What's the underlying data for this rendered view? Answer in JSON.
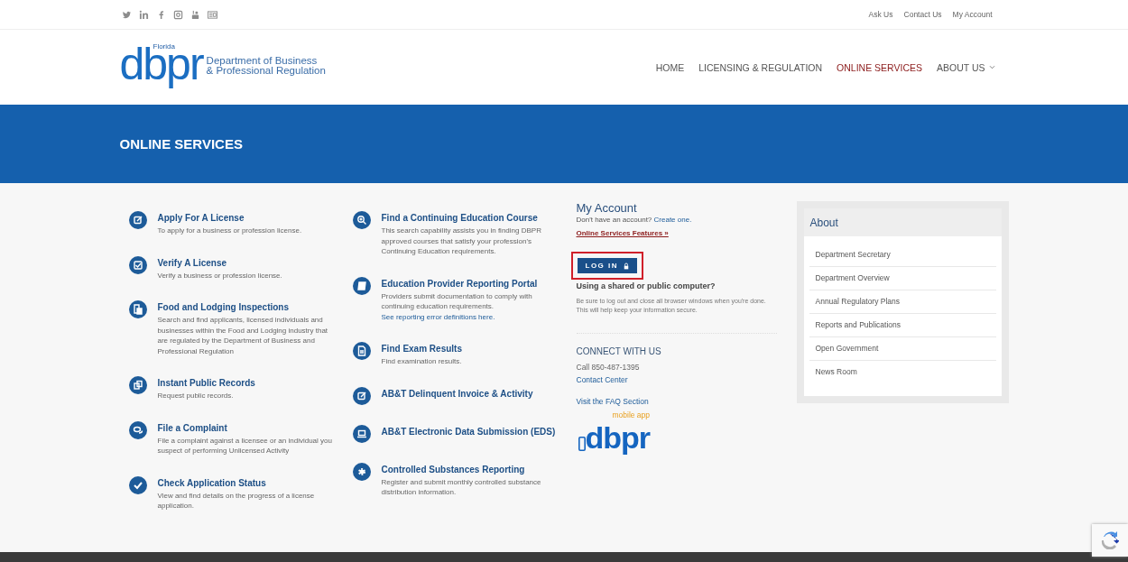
{
  "top_bar": {
    "links": [
      "Ask Us",
      "Contact Us",
      "My Account"
    ]
  },
  "header": {
    "logo": {
      "small": "Florida",
      "mark": "dbpr",
      "line_1": "Department of Business",
      "line_2": "& Professional Regulation"
    },
    "nav": [
      {
        "label": "HOME",
        "selected": false
      },
      {
        "label": "LICENSING & REGULATION",
        "selected": false
      },
      {
        "label": "ONLINE SERVICES",
        "selected": true
      },
      {
        "label": "ABOUT US",
        "selected": false,
        "dropdown": true
      }
    ]
  },
  "banner": {
    "title": "ONLINE SERVICES"
  },
  "services_left": [
    {
      "title": "Apply For A License",
      "description": "To apply for a business or profession license."
    },
    {
      "title": "Verify A License",
      "description": "Verify a business or profession license."
    },
    {
      "title": "Food and Lodging Inspections",
      "description": "Search and find applicants, licensed individuals and businesses within the Food and Lodging industry that are regulated by the Department of Business and Professional Regulation"
    },
    {
      "title": "Instant Public Records",
      "description": "Request public records."
    },
    {
      "title": "File a Complaint",
      "description": "File a complaint against a licensee or an individual you suspect of performing Unlicensed Activity"
    },
    {
      "title": "Check Application Status",
      "description": "View and find details on the progress of a license application."
    }
  ],
  "services_middle": [
    {
      "title": "Find a Continuing Education Course",
      "description": "This search capability assists you in finding DBPR approved courses that satisfy your profession's Continuing Education requirements."
    },
    {
      "title": "Education Provider Reporting Portal",
      "description": "Providers submit documentation to comply with continuing education requirements.",
      "link": "See reporting error definitions here."
    },
    {
      "title": "Find Exam Results",
      "description": "Find examination results."
    },
    {
      "title": "AB&T Delinquent Invoice & Activity"
    },
    {
      "title": "AB&T Electronic Data Submission (EDS)"
    },
    {
      "title": "Controlled Substances Reporting",
      "description": "Register and submit monthly controlled substance distribution information."
    }
  ],
  "my_account": {
    "title": "My Account",
    "prompt": "Don't have an account?",
    "create_link": "Create one.",
    "features_link": "Online Services Features »",
    "login_button": {
      "label": "LOG IN",
      "highlighted": true
    },
    "notice_title": "Using a shared or public computer?",
    "notice_text": "Be sure to log out and close all browser windows when you're done. This will help keep your information secure."
  },
  "connect": {
    "title": "CONNECT WITH US",
    "phone": "Call 850-487-1395",
    "links": [
      "Contact Center",
      "Visit the FAQ Section"
    ],
    "app_logo": {
      "mark": "dbpr",
      "tag": "mobile app"
    }
  },
  "about": {
    "title": "About",
    "items": [
      "Department Secretary",
      "Department Overview",
      "Annual Regulatory Plans",
      "Reports and Publications",
      "Open Government",
      "News Room"
    ]
  }
}
